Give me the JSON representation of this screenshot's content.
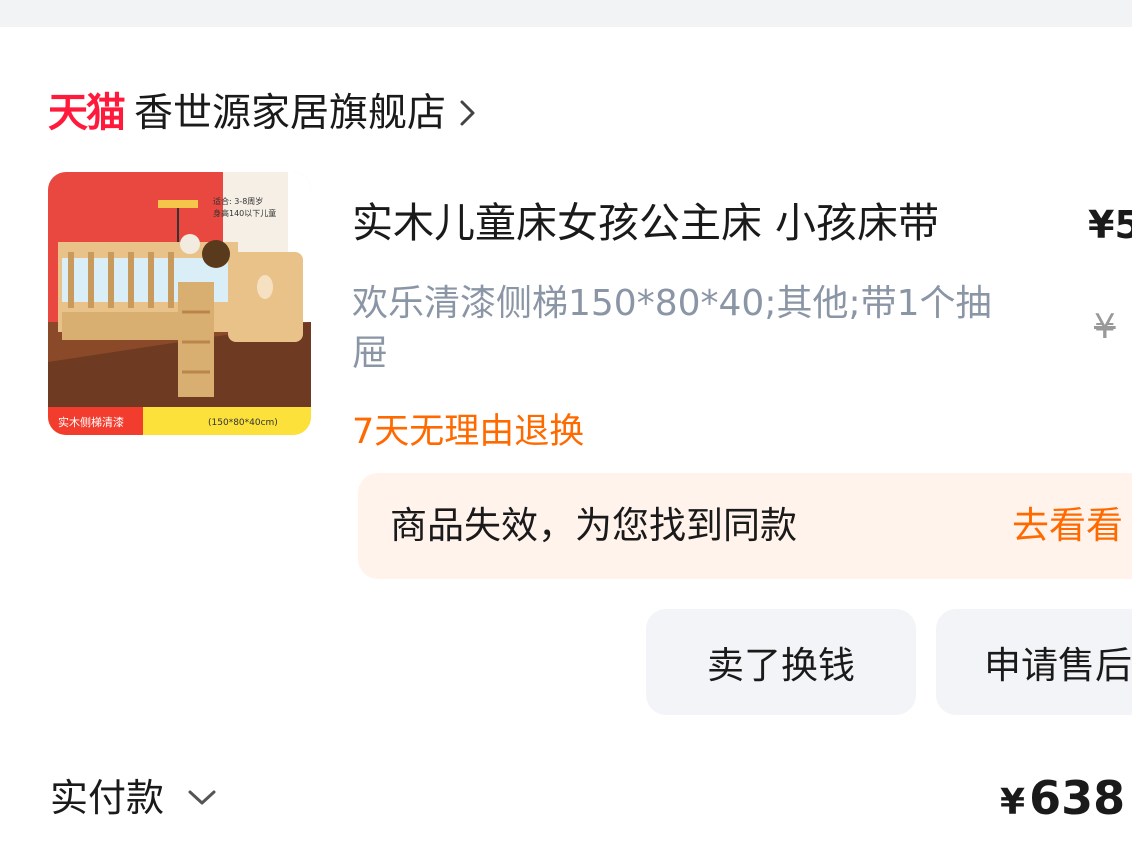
{
  "store": {
    "logo_text": "天猫",
    "name": "香世源家居旗舰店"
  },
  "product": {
    "image_badge": "实木侧梯清漆",
    "image_size": "(150*80*40cm)",
    "image_note_1": "适合: 3-8周岁",
    "image_note_2": "身高140以下儿童",
    "title": "实木儿童床女孩公主床 小孩床带",
    "sku": "欢乐清漆侧梯150*80*40;其他;带1个抽屉",
    "service_tag": "7天无理由退换",
    "price_current": "¥5",
    "price_original": "¥"
  },
  "notice": {
    "text": "商品失效，为您找到同款",
    "link": "去看看"
  },
  "actions": {
    "sell_label": "卖了换钱",
    "after_sale_label": "申请售后"
  },
  "payment": {
    "label": "实付款",
    "currency": "¥",
    "amount": "638"
  },
  "colors": {
    "tmall_red": "#ff1a3c",
    "accent_orange": "#ff6a00",
    "sku_gray": "#8a95a5",
    "banner_bg": "#fff3ec",
    "button_bg": "#f2f4f7"
  },
  "icons": [
    "chevron-right-icon",
    "chevron-down-icon"
  ]
}
